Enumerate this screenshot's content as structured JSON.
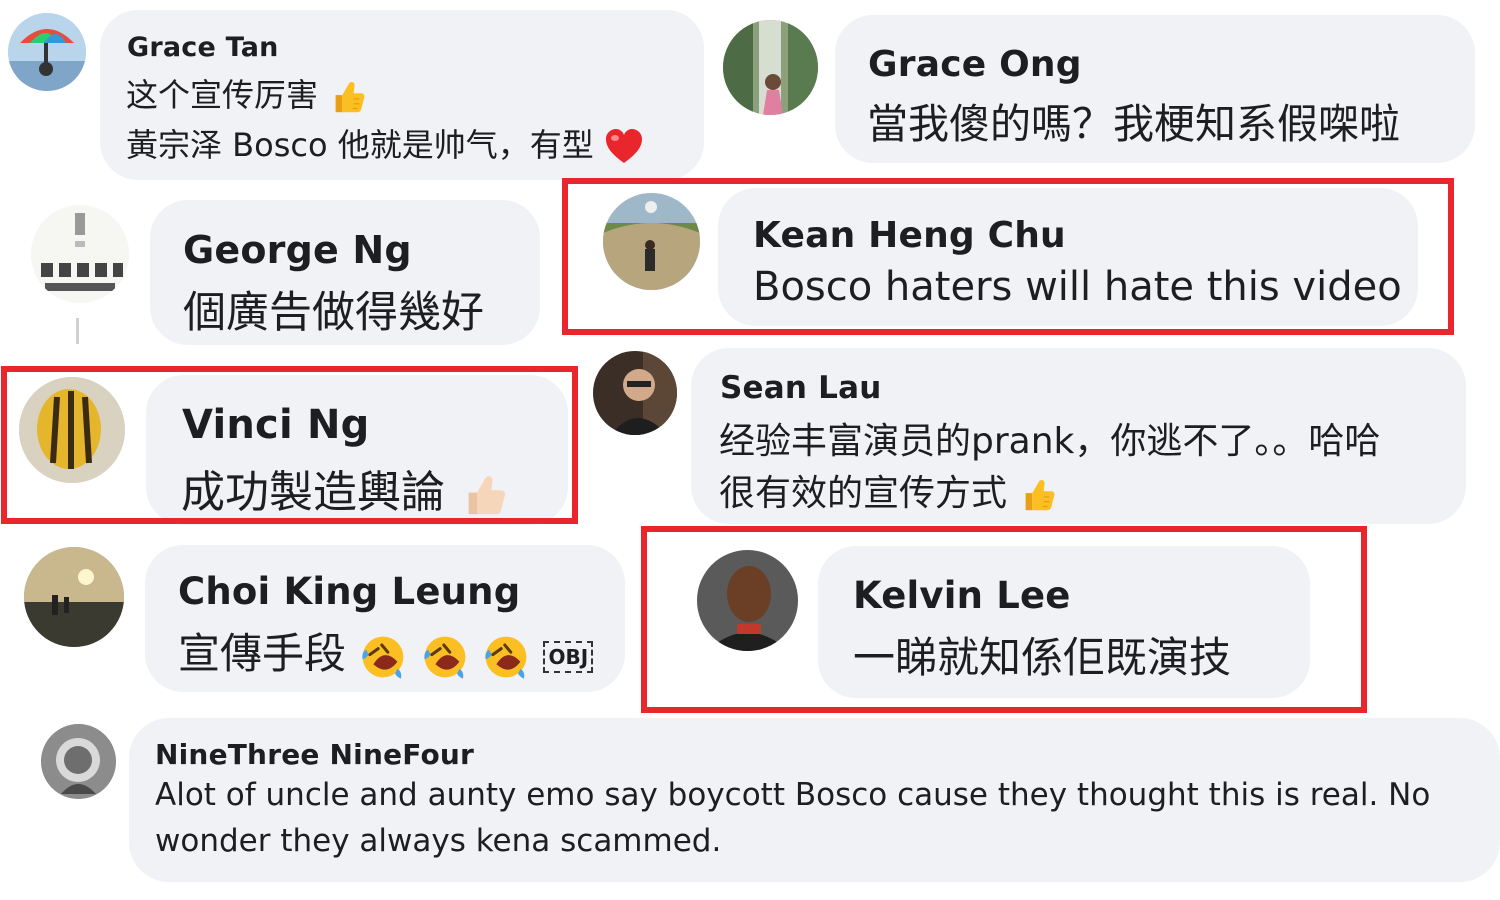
{
  "comments": [
    {
      "name": "Grace Tan",
      "lines": [
        "这个宣传厉害",
        "黃宗泽 Bosco 他就是帅气，有型"
      ],
      "emoji": [
        "thumbs-up",
        "heart"
      ]
    },
    {
      "name": "Grace Ong",
      "lines": [
        "當我傻的嗎？我梗知系假㗎啦"
      ]
    },
    {
      "name": "George Ng",
      "lines": [
        "個廣告做得幾好"
      ]
    },
    {
      "name": "Kean Heng Chu",
      "lines": [
        "Bosco haters will hate this video"
      ],
      "highlighted": true
    },
    {
      "name": "Vinci Ng",
      "lines": [
        "成功製造輿論"
      ],
      "emoji": [
        "thumbs-up"
      ],
      "highlighted": true
    },
    {
      "name": "Sean Lau",
      "lines": [
        "经验丰富演员的prank，你逃不了。。哈哈",
        "很有效的宣传方式"
      ],
      "emoji": [
        "thumbs-up"
      ]
    },
    {
      "name": "Choi King Leung",
      "lines": [
        "宣傳手段"
      ],
      "emoji": [
        "rofl",
        "rofl",
        "rofl"
      ],
      "trailing_glyph": "OBJ"
    },
    {
      "name": "Kelvin Lee",
      "lines": [
        "一睇就知係佢既演技"
      ],
      "highlighted": true
    },
    {
      "name": "NineThree NineFour",
      "lines": [
        "Alot of uncle and aunty emo say boycott Bosco cause they thought this is real. No",
        "wonder they always kena scammed."
      ]
    }
  ],
  "colors": {
    "bubble": "#f0f2f5",
    "highlight": "#e8262b",
    "text": "#1c1e21"
  }
}
